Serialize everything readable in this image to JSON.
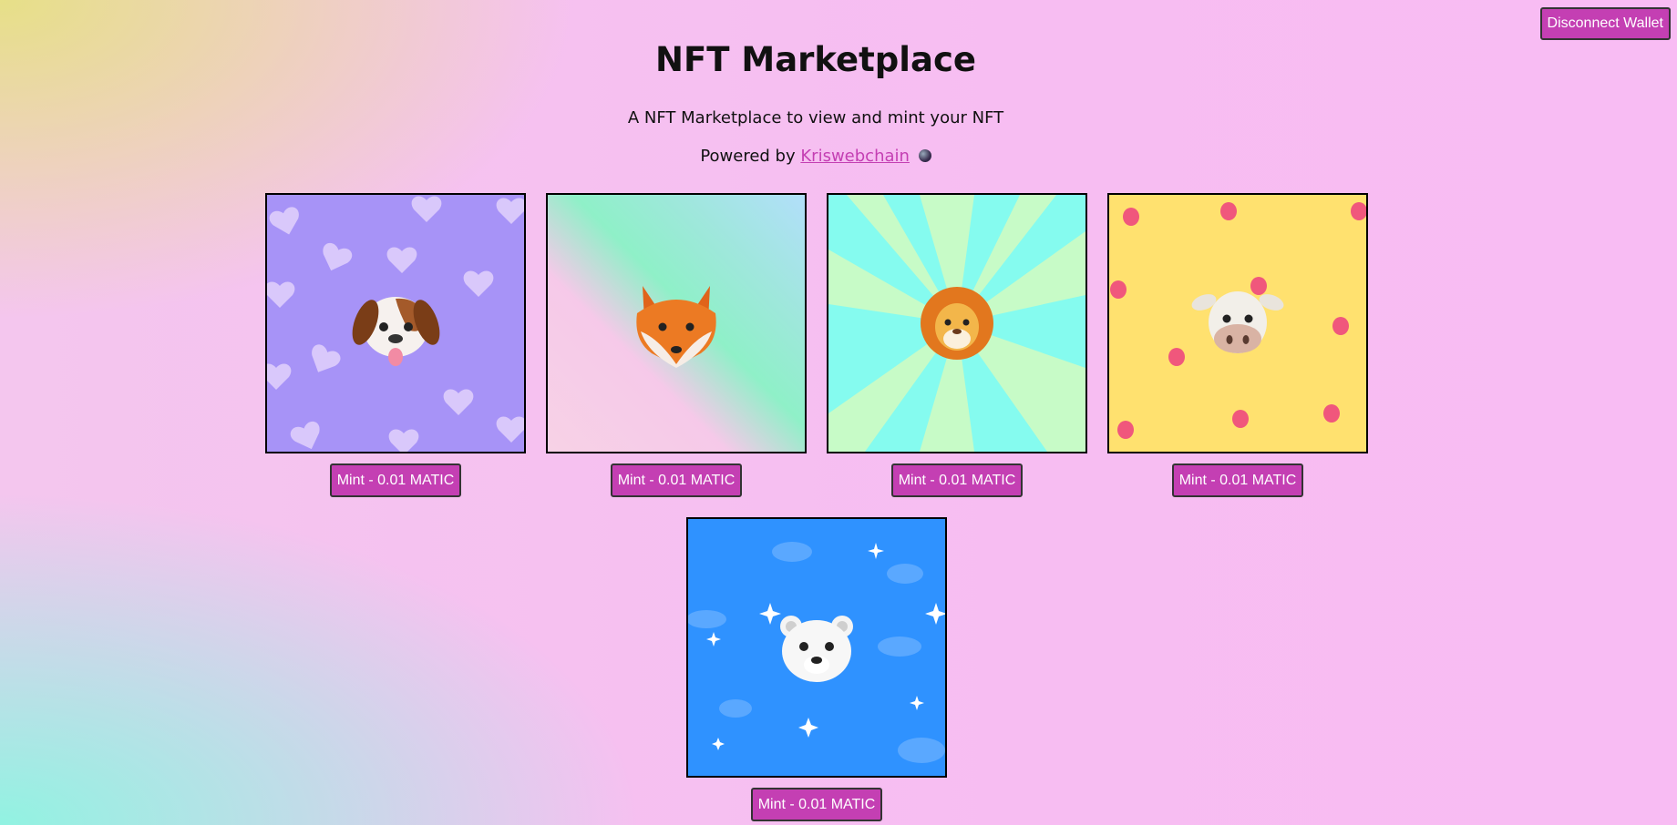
{
  "header": {
    "disconnect_label": "Disconnect Wallet",
    "title": "NFT Marketplace",
    "subtitle": "A NFT Marketplace to view and mint your NFT",
    "powered_prefix": "Powered by",
    "powered_link": "Kriswebchain"
  },
  "nfts": [
    {
      "animal": "dog",
      "background": "purple-hearts",
      "mint_label": "Mint - 0.01 MATIC"
    },
    {
      "animal": "fox",
      "background": "pastel-gradient",
      "mint_label": "Mint - 0.01 MATIC"
    },
    {
      "animal": "lion",
      "background": "sunburst",
      "mint_label": "Mint - 0.01 MATIC"
    },
    {
      "animal": "cow",
      "background": "yellow-strawberries",
      "mint_label": "Mint - 0.01 MATIC"
    },
    {
      "animal": "polar-bear",
      "background": "blue-sky-sparkles",
      "mint_label": "Mint - 0.01 MATIC"
    }
  ],
  "colors": {
    "accent": "#c43fb3"
  }
}
